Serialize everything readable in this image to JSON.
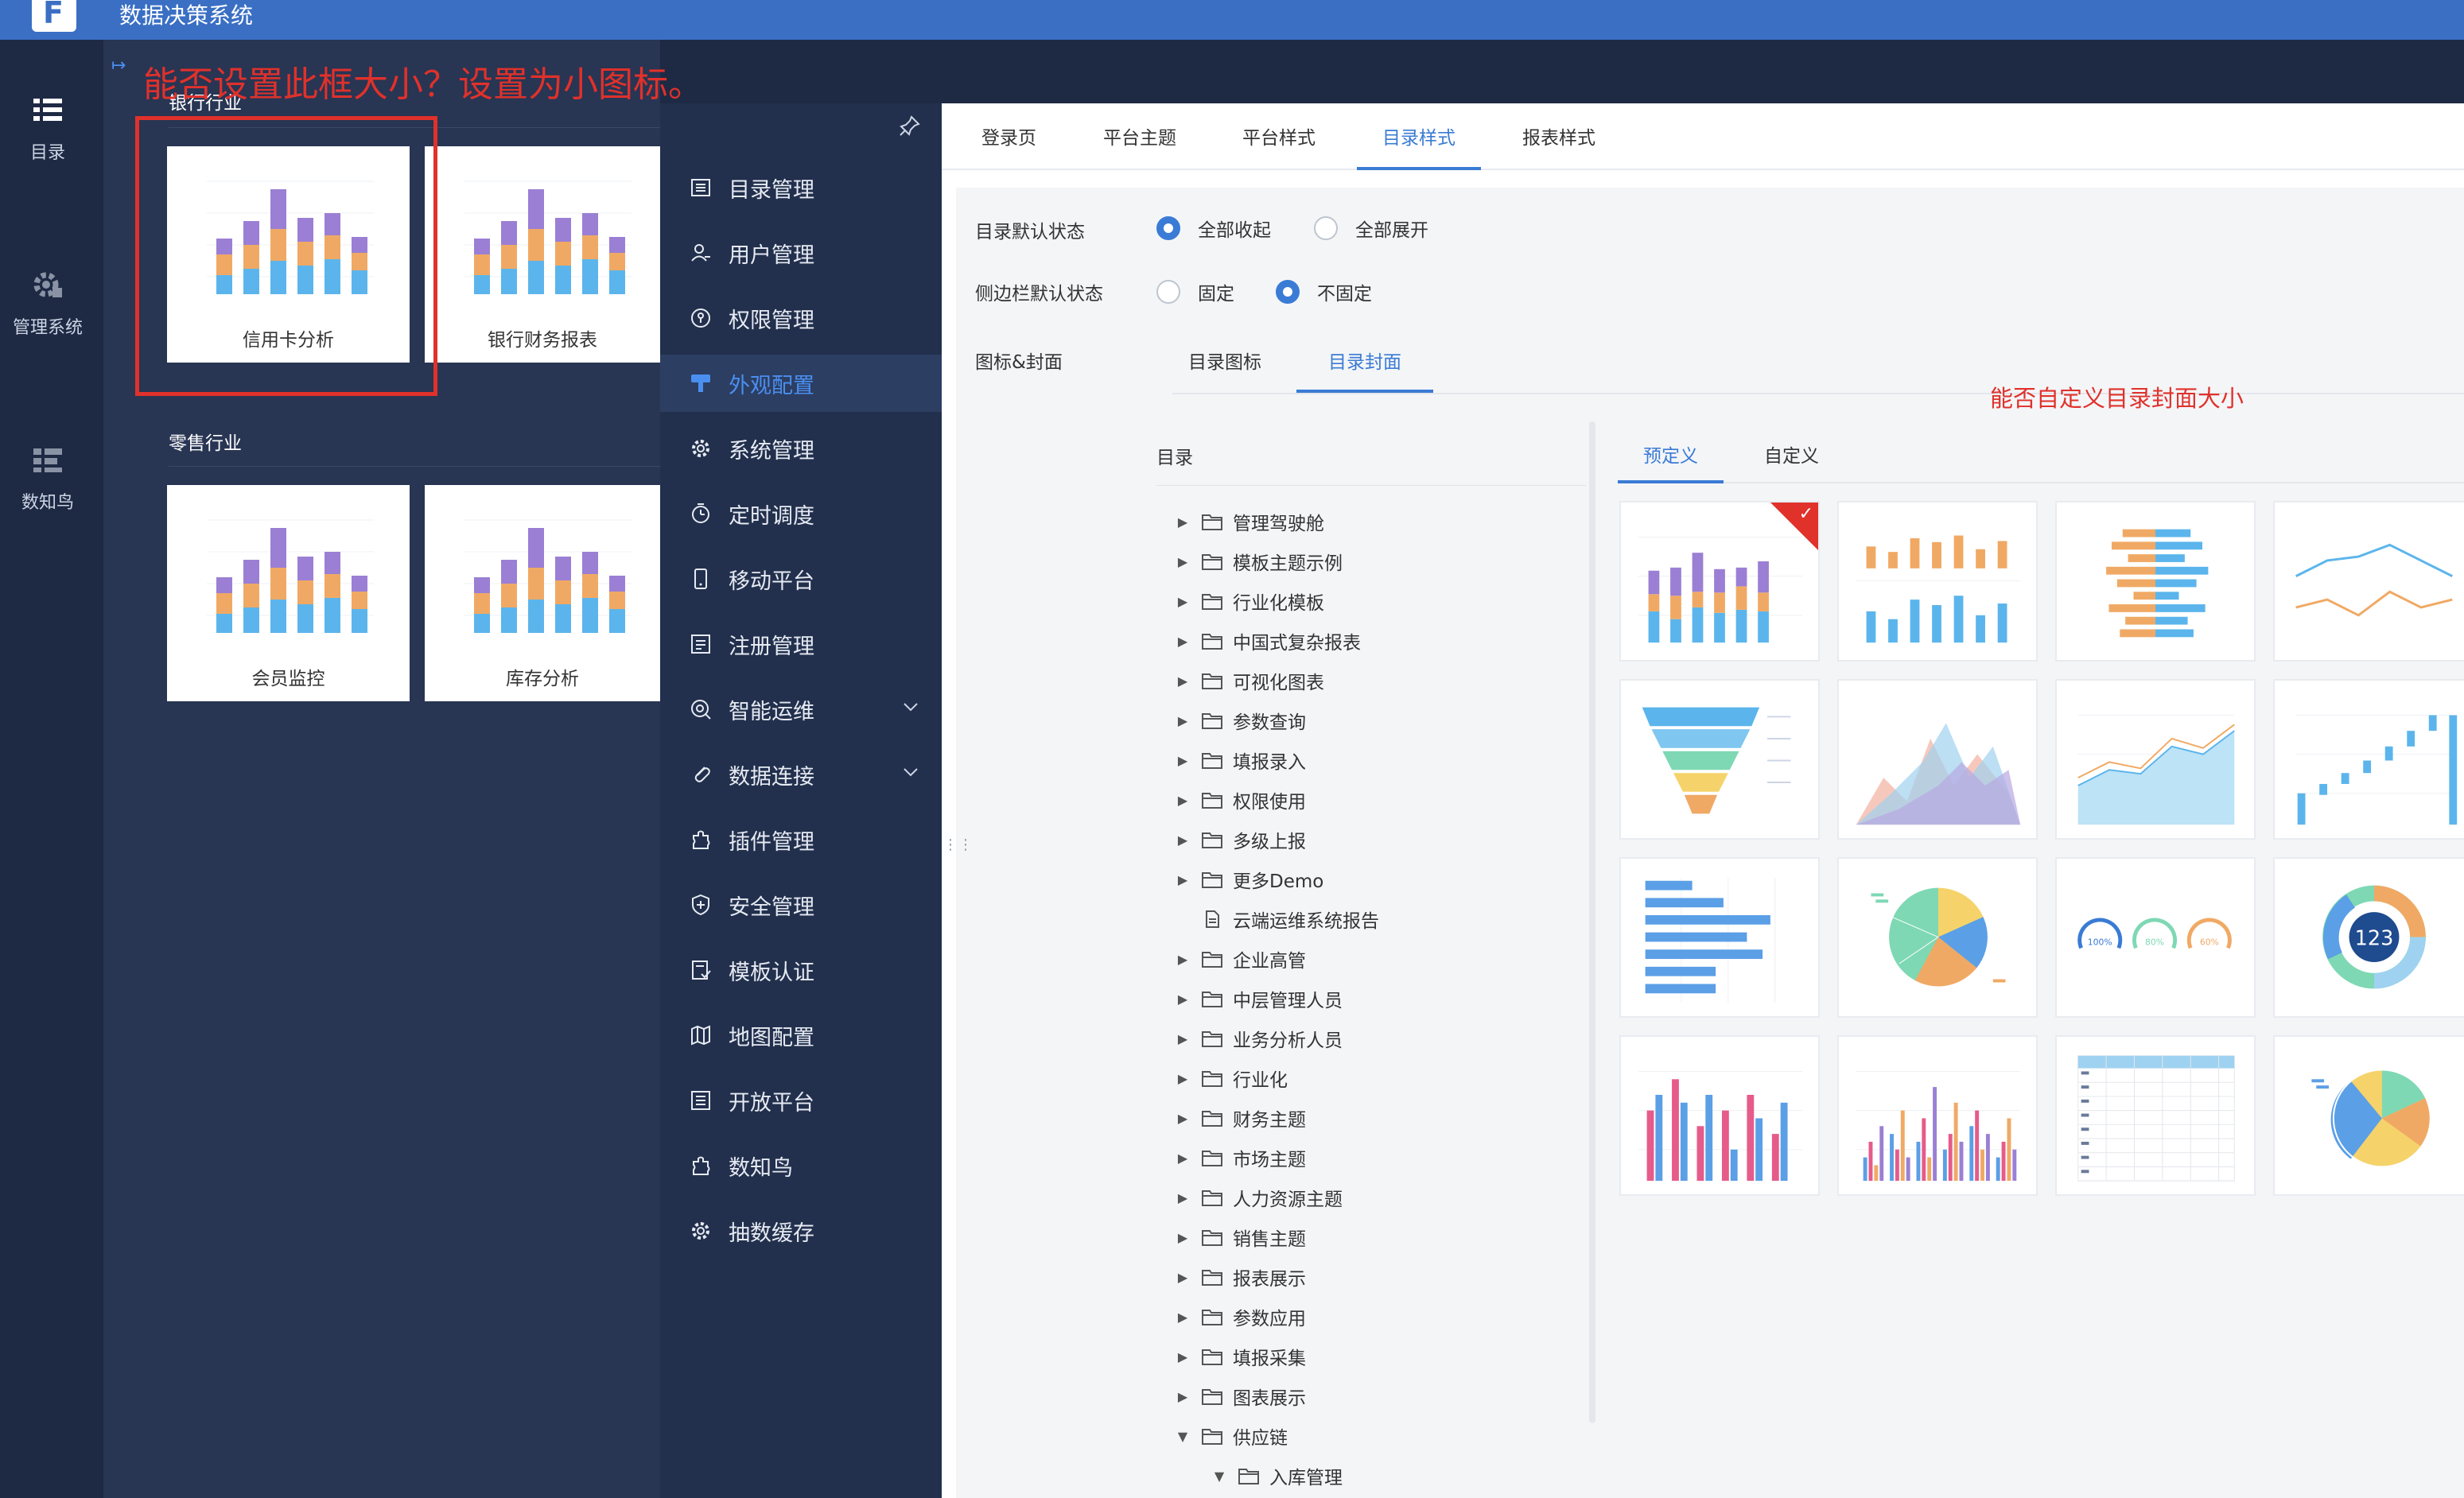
{
  "app": {
    "title": "数据决策系统"
  },
  "leftnav": [
    {
      "label": "目录",
      "icon": "catalog-icon"
    },
    {
      "label": "管理系统",
      "icon": "gear-icon"
    },
    {
      "label": "数知鸟",
      "icon": "list-icon"
    }
  ],
  "background": {
    "sections": [
      {
        "title": "银行行业",
        "cards": [
          "信用卡分析",
          "银行财务报表"
        ]
      },
      {
        "title": "零售行业",
        "cards": [
          "会员监控",
          "库存分析"
        ]
      }
    ]
  },
  "annotations": {
    "box_note": "能否设置此框大小？设置为小图标。",
    "cover_note": "能否自定义目录封面大小"
  },
  "settings_nav": [
    {
      "label": "目录管理",
      "icon": "list-icon"
    },
    {
      "label": "用户管理",
      "icon": "user-icon"
    },
    {
      "label": "权限管理",
      "icon": "shield-icon"
    },
    {
      "label": "外观配置",
      "icon": "brush-icon",
      "active": true
    },
    {
      "label": "系统管理",
      "icon": "gear-icon"
    },
    {
      "label": "定时调度",
      "icon": "clock-icon"
    },
    {
      "label": "移动平台",
      "icon": "mobile-icon"
    },
    {
      "label": "注册管理",
      "icon": "register-icon"
    },
    {
      "label": "智能运维",
      "icon": "ops-icon",
      "expandable": true
    },
    {
      "label": "数据连接",
      "icon": "link-icon",
      "expandable": true
    },
    {
      "label": "插件管理",
      "icon": "plugin-icon"
    },
    {
      "label": "安全管理",
      "icon": "security-icon"
    },
    {
      "label": "模板认证",
      "icon": "template-icon"
    },
    {
      "label": "地图配置",
      "icon": "map-icon"
    },
    {
      "label": "开放平台",
      "icon": "open-icon"
    },
    {
      "label": "数知鸟",
      "icon": "plugin-icon"
    },
    {
      "label": "抽数缓存",
      "icon": "gear-icon"
    }
  ],
  "tabs": [
    "登录页",
    "平台主题",
    "平台样式",
    "目录样式",
    "报表样式"
  ],
  "active_tab": "目录样式",
  "form": {
    "default_state_label": "目录默认状态",
    "default_state_options": [
      "全部收起",
      "全部展开"
    ],
    "default_state_selected": "全部收起",
    "sidebar_state_label": "侧边栏默认状态",
    "sidebar_state_options": [
      "固定",
      "不固定"
    ],
    "sidebar_state_selected": "不固定",
    "icon_cover_label": "图标&封面"
  },
  "subtabs": [
    "目录图标",
    "目录封面"
  ],
  "active_subtab": "目录封面",
  "tree": {
    "title": "目录",
    "items": [
      {
        "label": "管理驾驶舱",
        "type": "folder",
        "expanded": false,
        "level": 0
      },
      {
        "label": "模板主题示例",
        "type": "folder",
        "expanded": false,
        "level": 0
      },
      {
        "label": "行业化模板",
        "type": "folder",
        "expanded": false,
        "level": 0
      },
      {
        "label": "中国式复杂报表",
        "type": "folder",
        "expanded": false,
        "level": 0
      },
      {
        "label": "可视化图表",
        "type": "folder",
        "expanded": false,
        "level": 0
      },
      {
        "label": "参数查询",
        "type": "folder",
        "expanded": false,
        "level": 0
      },
      {
        "label": "填报录入",
        "type": "folder",
        "expanded": false,
        "level": 0
      },
      {
        "label": "权限使用",
        "type": "folder",
        "expanded": false,
        "level": 0
      },
      {
        "label": "多级上报",
        "type": "folder",
        "expanded": false,
        "level": 0
      },
      {
        "label": "更多Demo",
        "type": "folder",
        "expanded": false,
        "level": 0
      },
      {
        "label": "云端运维系统报告",
        "type": "file",
        "level": 0
      },
      {
        "label": "企业高管",
        "type": "folder",
        "expanded": false,
        "level": 0
      },
      {
        "label": "中层管理人员",
        "type": "folder",
        "expanded": false,
        "level": 0
      },
      {
        "label": "业务分析人员",
        "type": "folder",
        "expanded": false,
        "level": 0
      },
      {
        "label": "行业化",
        "type": "folder",
        "expanded": false,
        "level": 0
      },
      {
        "label": "财务主题",
        "type": "folder",
        "expanded": false,
        "level": 0
      },
      {
        "label": "市场主题",
        "type": "folder",
        "expanded": false,
        "level": 0
      },
      {
        "label": "人力资源主题",
        "type": "folder",
        "expanded": false,
        "level": 0
      },
      {
        "label": "销售主题",
        "type": "folder",
        "expanded": false,
        "level": 0
      },
      {
        "label": "报表展示",
        "type": "folder",
        "expanded": false,
        "level": 0
      },
      {
        "label": "参数应用",
        "type": "folder",
        "expanded": false,
        "level": 0
      },
      {
        "label": "填报采集",
        "type": "folder",
        "expanded": false,
        "level": 0
      },
      {
        "label": "图表展示",
        "type": "folder",
        "expanded": false,
        "level": 0
      },
      {
        "label": "供应链",
        "type": "folder",
        "expanded": true,
        "level": 0
      },
      {
        "label": "入库管理",
        "type": "folder",
        "expanded": true,
        "level": 1
      }
    ]
  },
  "gallery_tabs": [
    "预定义",
    "自定义"
  ],
  "active_gallery_tab": "预定义",
  "gallery": [
    {
      "kind": "stacked-bar",
      "selected": true
    },
    {
      "kind": "bar-orange-blue"
    },
    {
      "kind": "horizontal-bar-pair"
    },
    {
      "kind": "line"
    },
    {
      "kind": "funnel"
    },
    {
      "kind": "area-mountain"
    },
    {
      "kind": "area-line"
    },
    {
      "kind": "waterfall"
    },
    {
      "kind": "horizontal-bar"
    },
    {
      "kind": "pie"
    },
    {
      "kind": "gauges",
      "labels": [
        "100%",
        "80%",
        "60%"
      ]
    },
    {
      "kind": "donut",
      "label": "123"
    },
    {
      "kind": "grouped-bar-pink"
    },
    {
      "kind": "grouped-bar-multi"
    },
    {
      "kind": "table"
    },
    {
      "kind": "pie-small"
    }
  ],
  "colors": {
    "accent": "#3a7bd5",
    "annotation": "#e0312b",
    "topbar": "#3a6fc4",
    "sidebar": "#1e2a44"
  }
}
